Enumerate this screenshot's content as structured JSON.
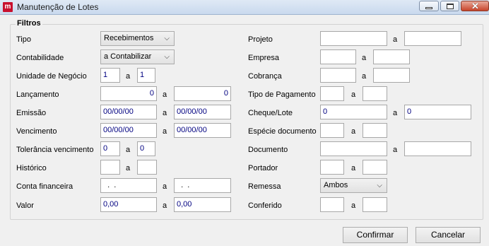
{
  "window": {
    "title": "Manutenção de Lotes",
    "icon": "app-logo-icon"
  },
  "group_title": "Filtros",
  "left": {
    "tipo": {
      "label": "Tipo",
      "value": "Recebimentos"
    },
    "contabilidade": {
      "label": "Contabilidade",
      "value": "a Contabilizar"
    },
    "unidade": {
      "label": "Unidade de Negócio",
      "from": "1",
      "sep": "a",
      "to": "1"
    },
    "lancamento": {
      "label": "Lançamento",
      "from": "0",
      "sep": "a",
      "to": "0"
    },
    "emissao": {
      "label": "Emissão",
      "from": "00/00/00",
      "sep": "a",
      "to": "00/00/00"
    },
    "vencimento": {
      "label": "Vencimento",
      "from": "00/00/00",
      "sep": "a",
      "to": "00/00/00"
    },
    "tolerancia": {
      "label": "Tolerância vencimento",
      "from": "0",
      "sep": "a",
      "to": "0"
    },
    "historico": {
      "label": "Histórico",
      "from": "",
      "sep": "a",
      "to": ""
    },
    "conta": {
      "label": "Conta financeira",
      "from": "  .  .",
      "sep": "a",
      "to": "  .  ."
    },
    "valor": {
      "label": "Valor",
      "from": "0,00",
      "sep": "a",
      "to": "0,00"
    }
  },
  "right": {
    "projeto": {
      "label": "Projeto",
      "from": "",
      "sep": "a",
      "to": ""
    },
    "empresa": {
      "label": "Empresa",
      "from": "",
      "sep": "a",
      "to": ""
    },
    "cobranca": {
      "label": "Cobrança",
      "from": "",
      "sep": "a",
      "to": ""
    },
    "tipo_pagamento": {
      "label": "Tipo de Pagamento",
      "from": "",
      "sep": "a",
      "to": ""
    },
    "cheque": {
      "label": "Cheque/Lote",
      "from": "0",
      "sep": "a",
      "to": "0"
    },
    "especie": {
      "label": "Espécie documento",
      "from": "",
      "sep": "a",
      "to": ""
    },
    "documento": {
      "label": "Documento",
      "from": "",
      "sep": "a",
      "to": ""
    },
    "portador": {
      "label": "Portador",
      "from": "",
      "sep": "a",
      "to": ""
    },
    "remessa": {
      "label": "Remessa",
      "value": "Ambos"
    },
    "conferido": {
      "label": "Conferido",
      "from": "",
      "sep": "a",
      "to": ""
    }
  },
  "buttons": {
    "confirmar": "Confirmar",
    "cancelar": "Cancelar"
  }
}
